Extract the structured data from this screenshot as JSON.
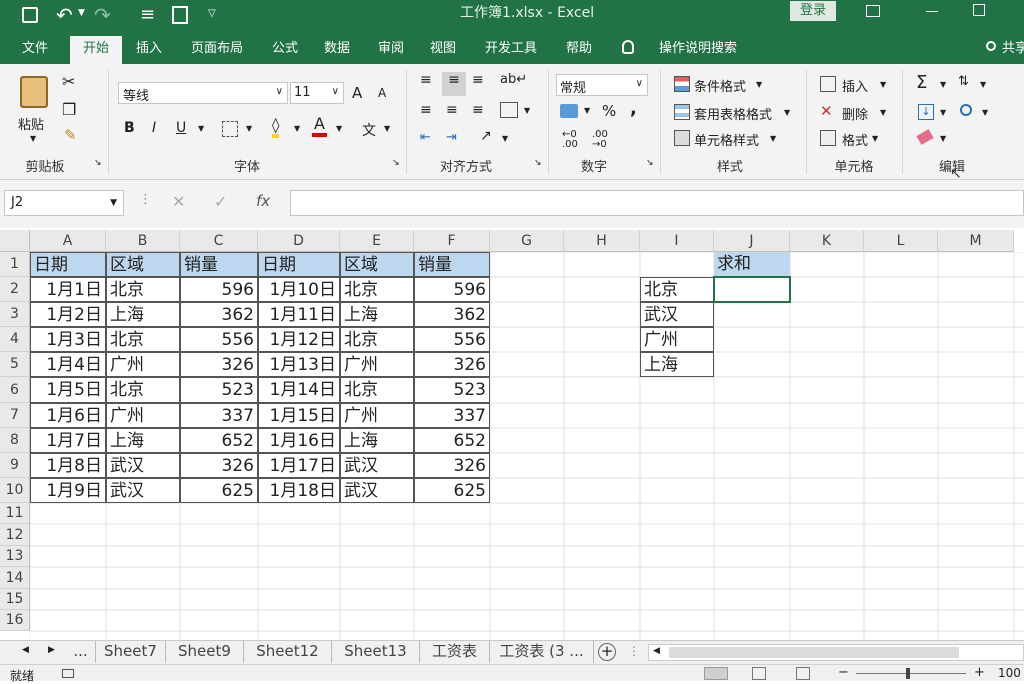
{
  "window": {
    "title": "工作簿1.xlsx  -  Excel",
    "login_label": "登录"
  },
  "tabs": [
    "文件",
    "开始",
    "插入",
    "页面布局",
    "公式",
    "数据",
    "审阅",
    "视图",
    "开发工具",
    "帮助",
    "操作说明搜索",
    "共享"
  ],
  "ribbon": {
    "clipboard": {
      "paste_label": "粘贴",
      "group_label": "剪贴板"
    },
    "font": {
      "font_name": "等线",
      "font_size": "11",
      "bold": "B",
      "italic": "I",
      "underline": "U",
      "font_color_glyph": "A",
      "phonetic_glyph": "文",
      "grow_glyph": "A",
      "shrink_glyph": "A",
      "group_label": "字体"
    },
    "alignment": {
      "group_label": "对齐方式"
    },
    "number": {
      "format": "常规",
      "percent": "%",
      "comma": ",",
      "group_label": "数字"
    },
    "styles": {
      "conditional": "条件格式",
      "table_format": "套用表格格式",
      "cell_styles": "单元格样式",
      "group_label": "样式"
    },
    "cells": {
      "insert": "插入",
      "delete": "删除",
      "format": "格式",
      "group_label": "单元格"
    },
    "editing": {
      "sum_glyph": "Σ",
      "group_label": "编辑"
    }
  },
  "formula_bar": {
    "name_box": "J2",
    "fx": "fx",
    "content": ""
  },
  "sheet": {
    "columns": [
      "A",
      "B",
      "C",
      "D",
      "E",
      "F",
      "G",
      "H",
      "I",
      "J",
      "K",
      "L",
      "M"
    ],
    "rows": [
      "1",
      "2",
      "3",
      "4",
      "5",
      "6",
      "7",
      "8",
      "9",
      "10",
      "11",
      "12",
      "13",
      "14",
      "15",
      "16"
    ],
    "headers": [
      "日期",
      "区域",
      "销量",
      "日期",
      "区域",
      "销量"
    ],
    "data": [
      [
        "1月1日",
        "北京",
        "596",
        "1月10日",
        "北京",
        "596"
      ],
      [
        "1月2日",
        "上海",
        "362",
        "1月11日",
        "上海",
        "362"
      ],
      [
        "1月3日",
        "北京",
        "556",
        "1月12日",
        "北京",
        "556"
      ],
      [
        "1月4日",
        "广州",
        "326",
        "1月13日",
        "广州",
        "326"
      ],
      [
        "1月5日",
        "北京",
        "523",
        "1月14日",
        "北京",
        "523"
      ],
      [
        "1月6日",
        "广州",
        "337",
        "1月15日",
        "广州",
        "337"
      ],
      [
        "1月7日",
        "上海",
        "652",
        "1月16日",
        "上海",
        "652"
      ],
      [
        "1月8日",
        "武汉",
        "326",
        "1月17日",
        "武汉",
        "326"
      ],
      [
        "1月9日",
        "武汉",
        "625",
        "1月18日",
        "武汉",
        "625"
      ]
    ],
    "criteria": [
      "北京",
      "武汉",
      "广州",
      "上海"
    ],
    "sum_header": "求和"
  },
  "sheet_tabs": [
    "...",
    "Sheet7",
    "Sheet9",
    "Sheet12",
    "Sheet13",
    "工资表",
    "工资表 (3 ..."
  ],
  "status": {
    "ready": "就绪",
    "zoom": "100"
  },
  "colors": {
    "accent": "#217346",
    "header_fill": "#bdd7ee"
  }
}
